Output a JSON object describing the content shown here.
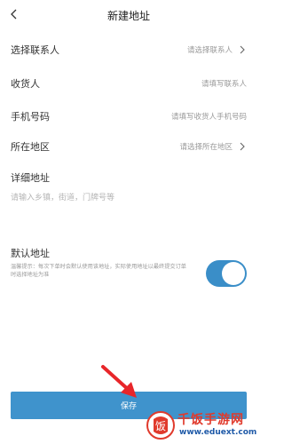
{
  "header": {
    "title": "新建地址"
  },
  "form": {
    "contact": {
      "label": "选择联系人",
      "value": "请选择联系人"
    },
    "receiver": {
      "label": "收货人",
      "placeholder": "请填写联系人"
    },
    "phone": {
      "label": "手机号码",
      "placeholder": "请填写收货人手机号码"
    },
    "region": {
      "label": "所在地区",
      "value": "请选择所在地区"
    },
    "detail": {
      "label": "详细地址",
      "placeholder": "请输入乡镇，街道，门牌号等"
    }
  },
  "default_address": {
    "label": "默认地址",
    "hint": "温馨提示：每次下单时会默认使用该地址，实际使用地址以最终提交订单时选择地址为准",
    "enabled": true,
    "color": "#3a8ec8"
  },
  "save_button": {
    "label": "保存",
    "color": "#3f93cc"
  },
  "watermark": {
    "brand": "千饭手游网",
    "url": "www.eduext.com"
  },
  "icons": {
    "back": "chevron-left-icon",
    "chevron": "chevron-right-icon",
    "annotation_arrow": "arrow-icon",
    "watermark_logo": "logo-icon"
  }
}
